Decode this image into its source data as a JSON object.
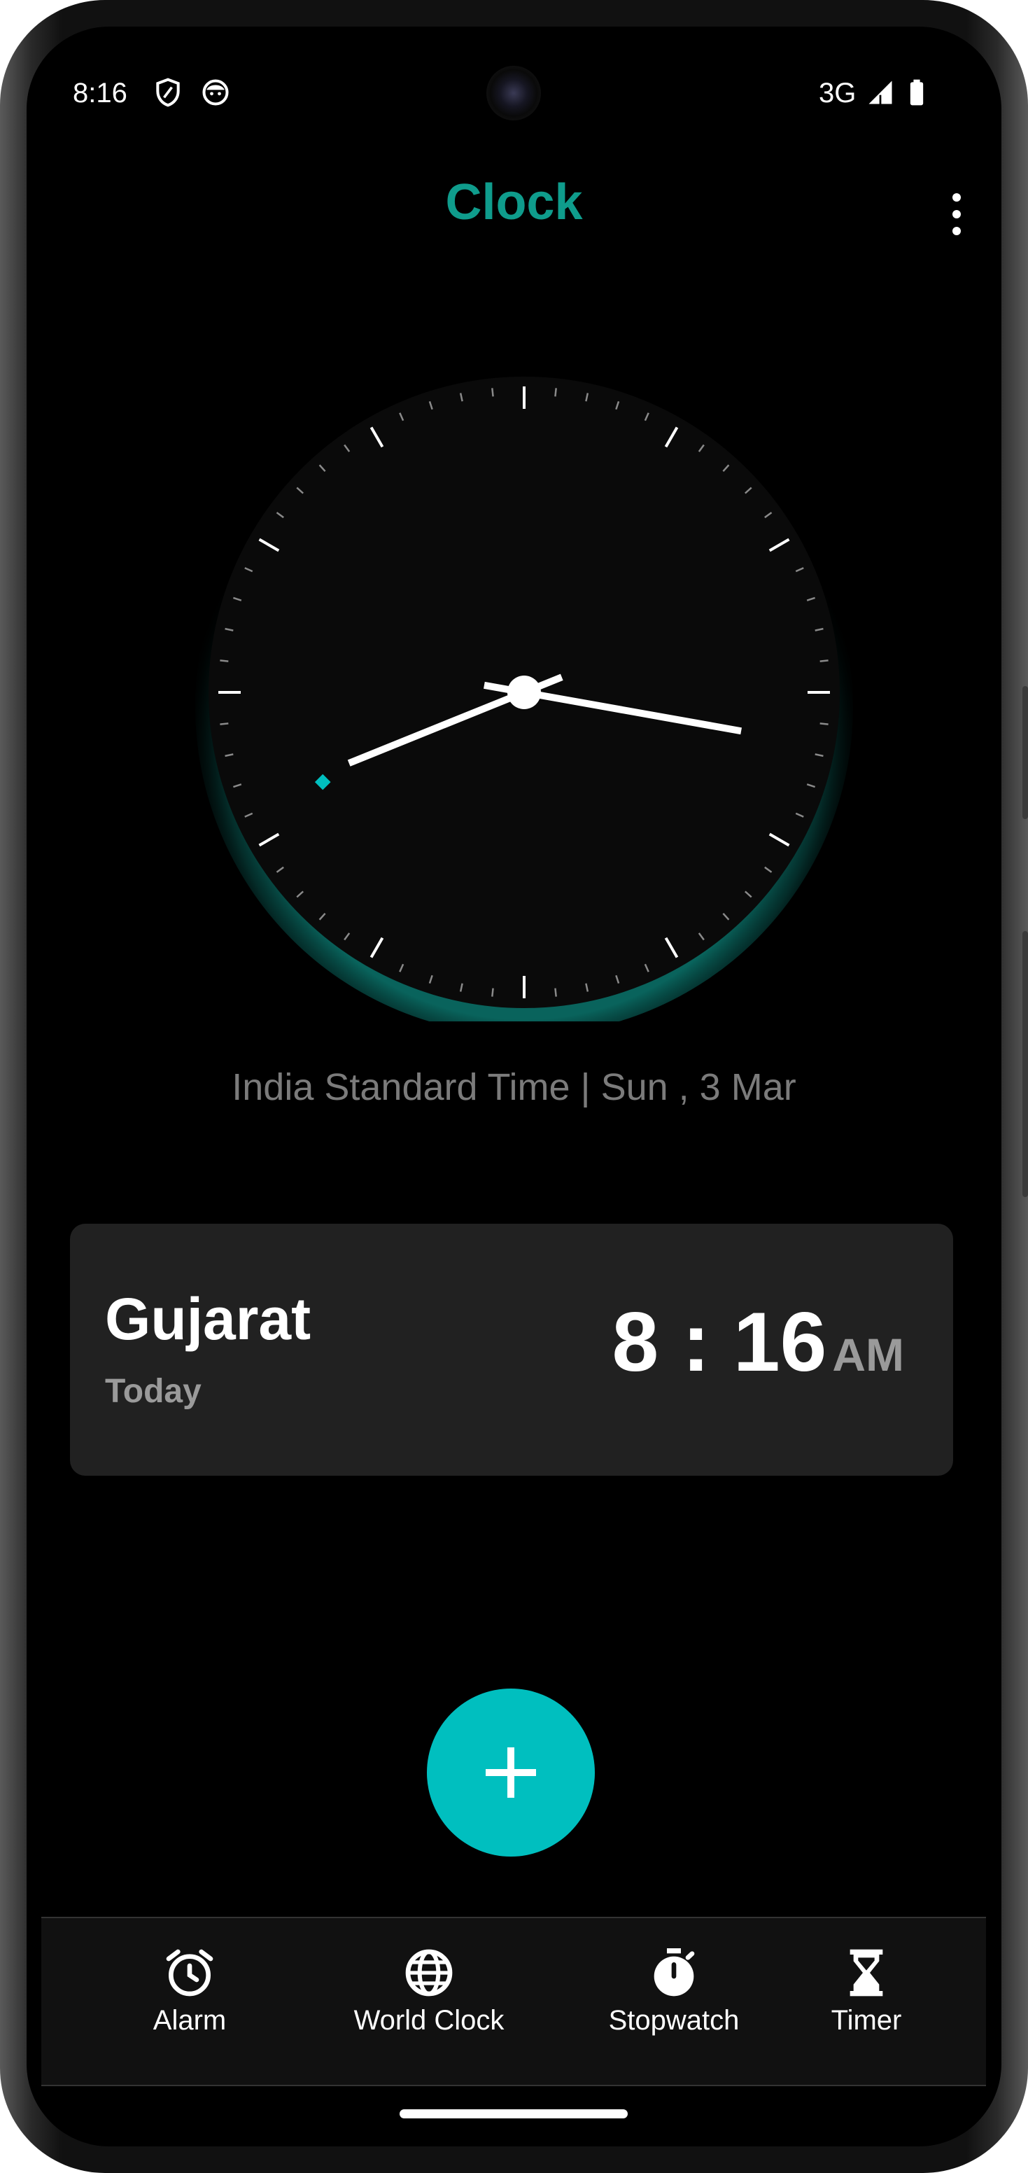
{
  "status_bar": {
    "time": "8:16",
    "network": "3G",
    "icons": [
      "shield-icon",
      "face-icon",
      "signal-icon",
      "battery-icon"
    ]
  },
  "app_bar": {
    "title": "Clock",
    "title_color": "#0f9c8c",
    "menu_icon": "more-vert-icon"
  },
  "analog_clock": {
    "hour": 8,
    "minute": 16,
    "second": 41,
    "accent_color": "#00bfbf"
  },
  "timezone_line": "India Standard Time | Sun , 3 Mar",
  "world_clocks": [
    {
      "city": "Gujarat",
      "day": "Today",
      "time": "8 : 16",
      "ampm": "AM"
    }
  ],
  "fab": {
    "icon": "plus-icon",
    "color": "#00bfbf"
  },
  "bottom_nav": {
    "items": [
      {
        "label": "Alarm",
        "icon": "alarm-icon"
      },
      {
        "label": "World Clock",
        "icon": "globe-icon"
      },
      {
        "label": "Stopwatch",
        "icon": "stopwatch-icon"
      },
      {
        "label": "Timer",
        "icon": "hourglass-icon"
      }
    ]
  }
}
